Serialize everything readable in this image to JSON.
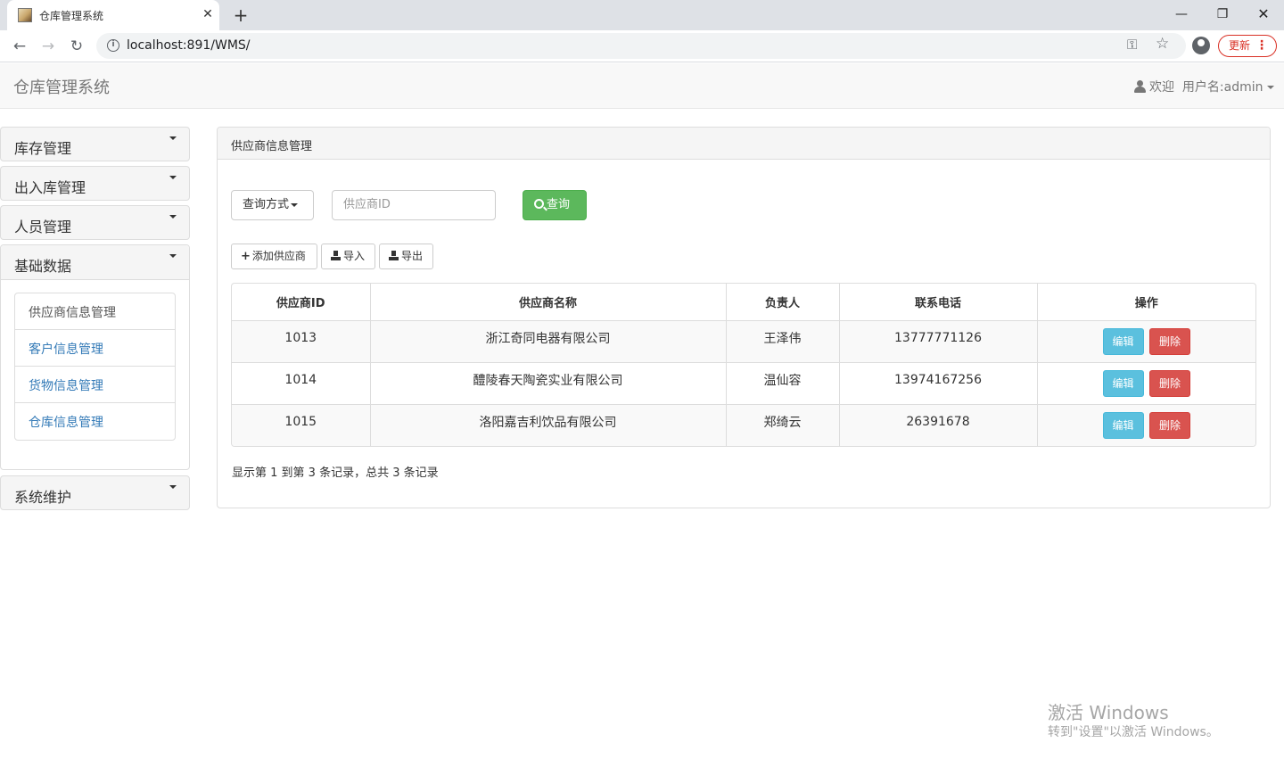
{
  "browser": {
    "tab_title": "仓库管理系统",
    "tab_close": "✕",
    "new_tab": "+",
    "url": "localhost:891/WMS/",
    "update_label": "更新",
    "window_minimize": "—",
    "window_maximize": "❐",
    "window_close": "✕"
  },
  "navbar": {
    "brand": "仓库管理系统",
    "welcome": "欢迎",
    "username": "用户名:admin"
  },
  "sidebar": {
    "sections": [
      {
        "label": "库存管理"
      },
      {
        "label": "出入库管理"
      },
      {
        "label": "人员管理"
      },
      {
        "label": "基础数据"
      },
      {
        "label": "系统维护"
      }
    ],
    "basic_items": [
      {
        "label": "供应商信息管理"
      },
      {
        "label": "客户信息管理"
      },
      {
        "label": "货物信息管理"
      },
      {
        "label": "仓库信息管理"
      }
    ]
  },
  "panel": {
    "heading": "供应商信息管理",
    "query_mode_label": "查询方式",
    "search_placeholder": "供应商ID",
    "search_button": "查询",
    "add_button": "添加供应商",
    "import_button": "导入",
    "export_button": "导出",
    "columns": [
      "供应商ID",
      "供应商名称",
      "负责人",
      "联系电话",
      "操作"
    ],
    "rows": [
      {
        "id": "1013",
        "name": "浙江奇同电器有限公司",
        "person": "王泽伟",
        "phone": "13777771126"
      },
      {
        "id": "1014",
        "name": "醴陵春天陶瓷实业有限公司",
        "person": "温仙容",
        "phone": "13974167256"
      },
      {
        "id": "1015",
        "name": "洛阳嘉吉利饮品有限公司",
        "person": "郑绮云",
        "phone": "26391678"
      }
    ],
    "edit_label": "编辑",
    "delete_label": "删除",
    "record_info": "显示第 1 到第 3 条记录，总共 3 条记录"
  },
  "watermark": {
    "title": "激活 Windows",
    "subtitle": "转到\"设置\"以激活 Windows。"
  }
}
